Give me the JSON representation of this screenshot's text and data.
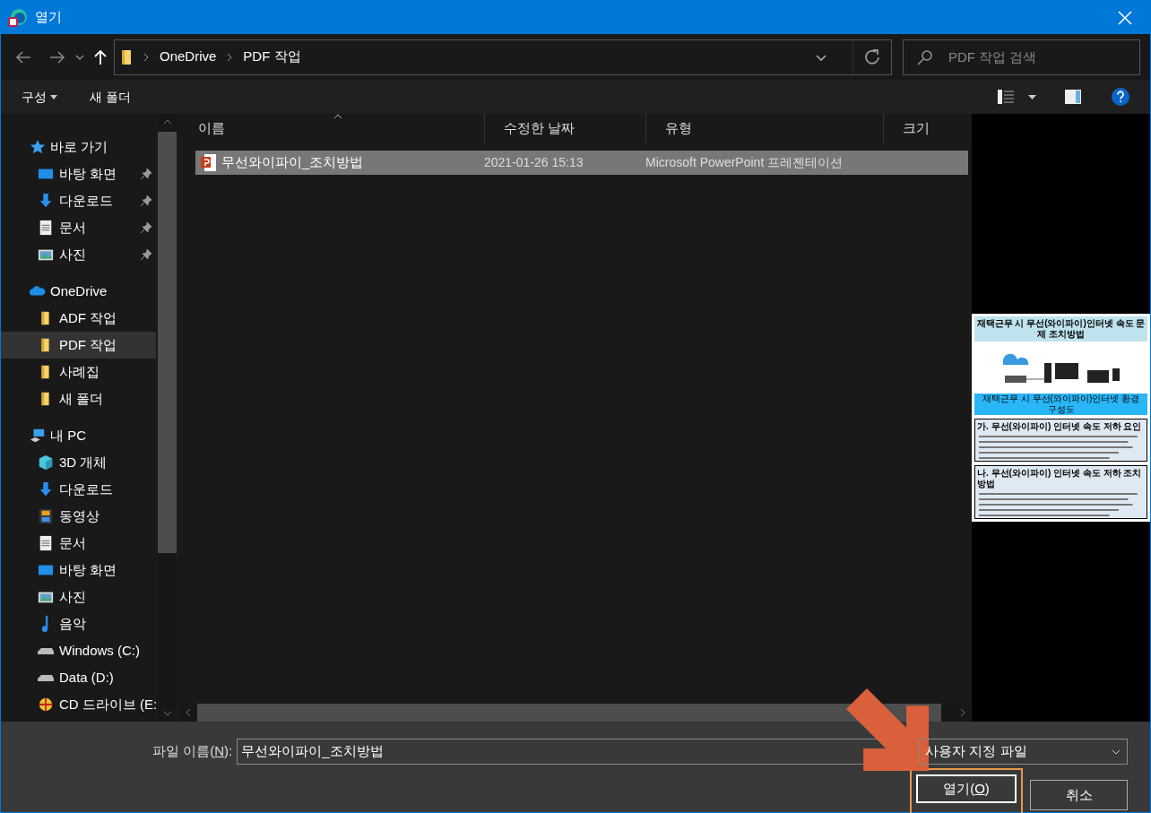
{
  "window": {
    "title": "열기"
  },
  "nav": {
    "breadcrumb": [
      "OneDrive",
      "PDF 작업"
    ],
    "search": {
      "placeholder": "PDF 작업 검색"
    }
  },
  "toolbar": {
    "organize": "구성",
    "new_folder": "새 폴더"
  },
  "sidebar": {
    "items": [
      {
        "label": "바로 가기",
        "selected": false,
        "children": [
          {
            "label": "바탕 화면",
            "pinned": true,
            "selected": false
          },
          {
            "label": "다운로드",
            "pinned": true,
            "selected": false
          },
          {
            "label": "문서",
            "pinned": true,
            "selected": false
          },
          {
            "label": "사진",
            "pinned": true,
            "selected": false
          }
        ]
      },
      {
        "label": "OneDrive",
        "selected": false,
        "children": [
          {
            "label": "ADF 작업",
            "selected": false
          },
          {
            "label": "PDF 작업",
            "selected": true
          },
          {
            "label": "사례집",
            "selected": false
          },
          {
            "label": "새 폴더",
            "selected": false
          }
        ]
      },
      {
        "label": "내 PC",
        "selected": false,
        "children": [
          {
            "label": "3D 개체",
            "selected": false
          },
          {
            "label": "다운로드",
            "selected": false
          },
          {
            "label": "동영상",
            "selected": false
          },
          {
            "label": "문서",
            "selected": false
          },
          {
            "label": "바탕 화면",
            "selected": false
          },
          {
            "label": "사진",
            "selected": false
          },
          {
            "label": "음악",
            "selected": false
          },
          {
            "label": "Windows (C:)",
            "selected": false
          },
          {
            "label": "Data (D:)",
            "selected": false
          },
          {
            "label": "CD 드라이브 (E:",
            "selected": false
          }
        ]
      }
    ]
  },
  "table": {
    "columns": [
      "이름",
      "수정한 날짜",
      "유형",
      "크기"
    ],
    "rows": [
      {
        "name": "무선와이파이_조치방법",
        "modified": "2021-01-26 15:13",
        "type": "Microsoft PowerPoint 프레젠테이션",
        "selected": true
      }
    ]
  },
  "preview": {
    "title": "재택근무 시 무선(와이파이)인터넷 속도 문제 조치방법",
    "caption": "재택근무 시 무선(와이파이)인터넷 환경 구성도",
    "sections": [
      "가. 무선(와이파이) 인터넷 속도 저하 요인",
      "나. 무선(와이파이) 인터넷 속도 저하 조치 방법"
    ]
  },
  "footer": {
    "filename_label": "파일 이름(",
    "filename_key": "N",
    "filename_label_end": "):",
    "filename_value": "무선와이파이_조치방법",
    "filetype": "사용자 지정 파일",
    "open": "열기(",
    "open_key": "O",
    "open_end": ")",
    "cancel": "취소"
  }
}
